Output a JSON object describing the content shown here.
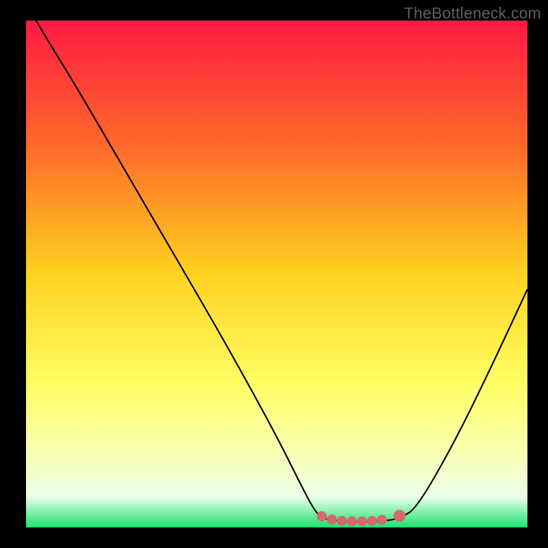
{
  "watermark": "TheBottleneck.com",
  "chart_data": {
    "type": "line",
    "title": "",
    "xlabel": "",
    "ylabel": "",
    "xlim": [
      0,
      100
    ],
    "ylim": [
      0,
      100
    ],
    "gradient_stops": [
      {
        "offset": 0,
        "color": "#ff1a44"
      },
      {
        "offset": 25,
        "color": "#ff6a2a"
      },
      {
        "offset": 50,
        "color": "#ffd21f"
      },
      {
        "offset": 72,
        "color": "#ffff66"
      },
      {
        "offset": 85,
        "color": "#f8ffb0"
      },
      {
        "offset": 94,
        "color": "#eaffea"
      },
      {
        "offset": 100,
        "color": "#19e36e"
      }
    ],
    "series": [
      {
        "name": "bottleneck-curve",
        "color": "#000000",
        "points": [
          {
            "x": 2,
            "y": 100
          },
          {
            "x": 5,
            "y": 95
          },
          {
            "x": 10,
            "y": 87
          },
          {
            "x": 20,
            "y": 70
          },
          {
            "x": 30,
            "y": 53
          },
          {
            "x": 40,
            "y": 36
          },
          {
            "x": 50,
            "y": 18
          },
          {
            "x": 55,
            "y": 8
          },
          {
            "x": 58,
            "y": 2.5
          },
          {
            "x": 60,
            "y": 1.5
          },
          {
            "x": 66,
            "y": 1
          },
          {
            "x": 72,
            "y": 1.3
          },
          {
            "x": 75,
            "y": 2
          },
          {
            "x": 78,
            "y": 4
          },
          {
            "x": 85,
            "y": 16
          },
          {
            "x": 92,
            "y": 30
          },
          {
            "x": 100,
            "y": 47
          }
        ]
      }
    ],
    "markers": [
      {
        "x": 59,
        "y": 2.2,
        "color": "#d46a6a",
        "r": 1.0
      },
      {
        "x": 61,
        "y": 1.6,
        "color": "#d46a6a",
        "r": 1.0
      },
      {
        "x": 63,
        "y": 1.3,
        "color": "#d46a6a",
        "r": 1.0
      },
      {
        "x": 65,
        "y": 1.2,
        "color": "#d46a6a",
        "r": 1.0
      },
      {
        "x": 67,
        "y": 1.2,
        "color": "#d46a6a",
        "r": 1.0
      },
      {
        "x": 69,
        "y": 1.3,
        "color": "#d46a6a",
        "r": 1.0
      },
      {
        "x": 71,
        "y": 1.5,
        "color": "#d46a6a",
        "r": 1.0
      },
      {
        "x": 74.5,
        "y": 2.3,
        "color": "#d46a6a",
        "r": 1.2
      }
    ]
  }
}
